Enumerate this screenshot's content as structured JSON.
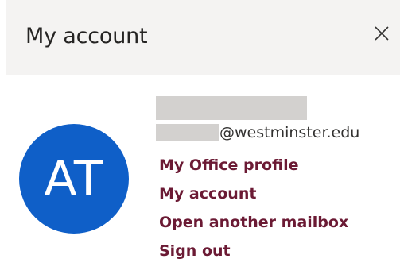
{
  "header": {
    "title": "My account",
    "close_icon": "close-icon"
  },
  "profile": {
    "avatar_initials": "AT",
    "avatar_color": "#0f5fc8",
    "email_domain": "@westminster.edu"
  },
  "links": [
    {
      "label": "My Office profile"
    },
    {
      "label": "My account"
    },
    {
      "label": "Open another mailbox"
    },
    {
      "label": "Sign out"
    }
  ],
  "colors": {
    "link": "#6b1a34",
    "header_bg": "#f4f3f2",
    "redaction": "#d3d1cf"
  }
}
